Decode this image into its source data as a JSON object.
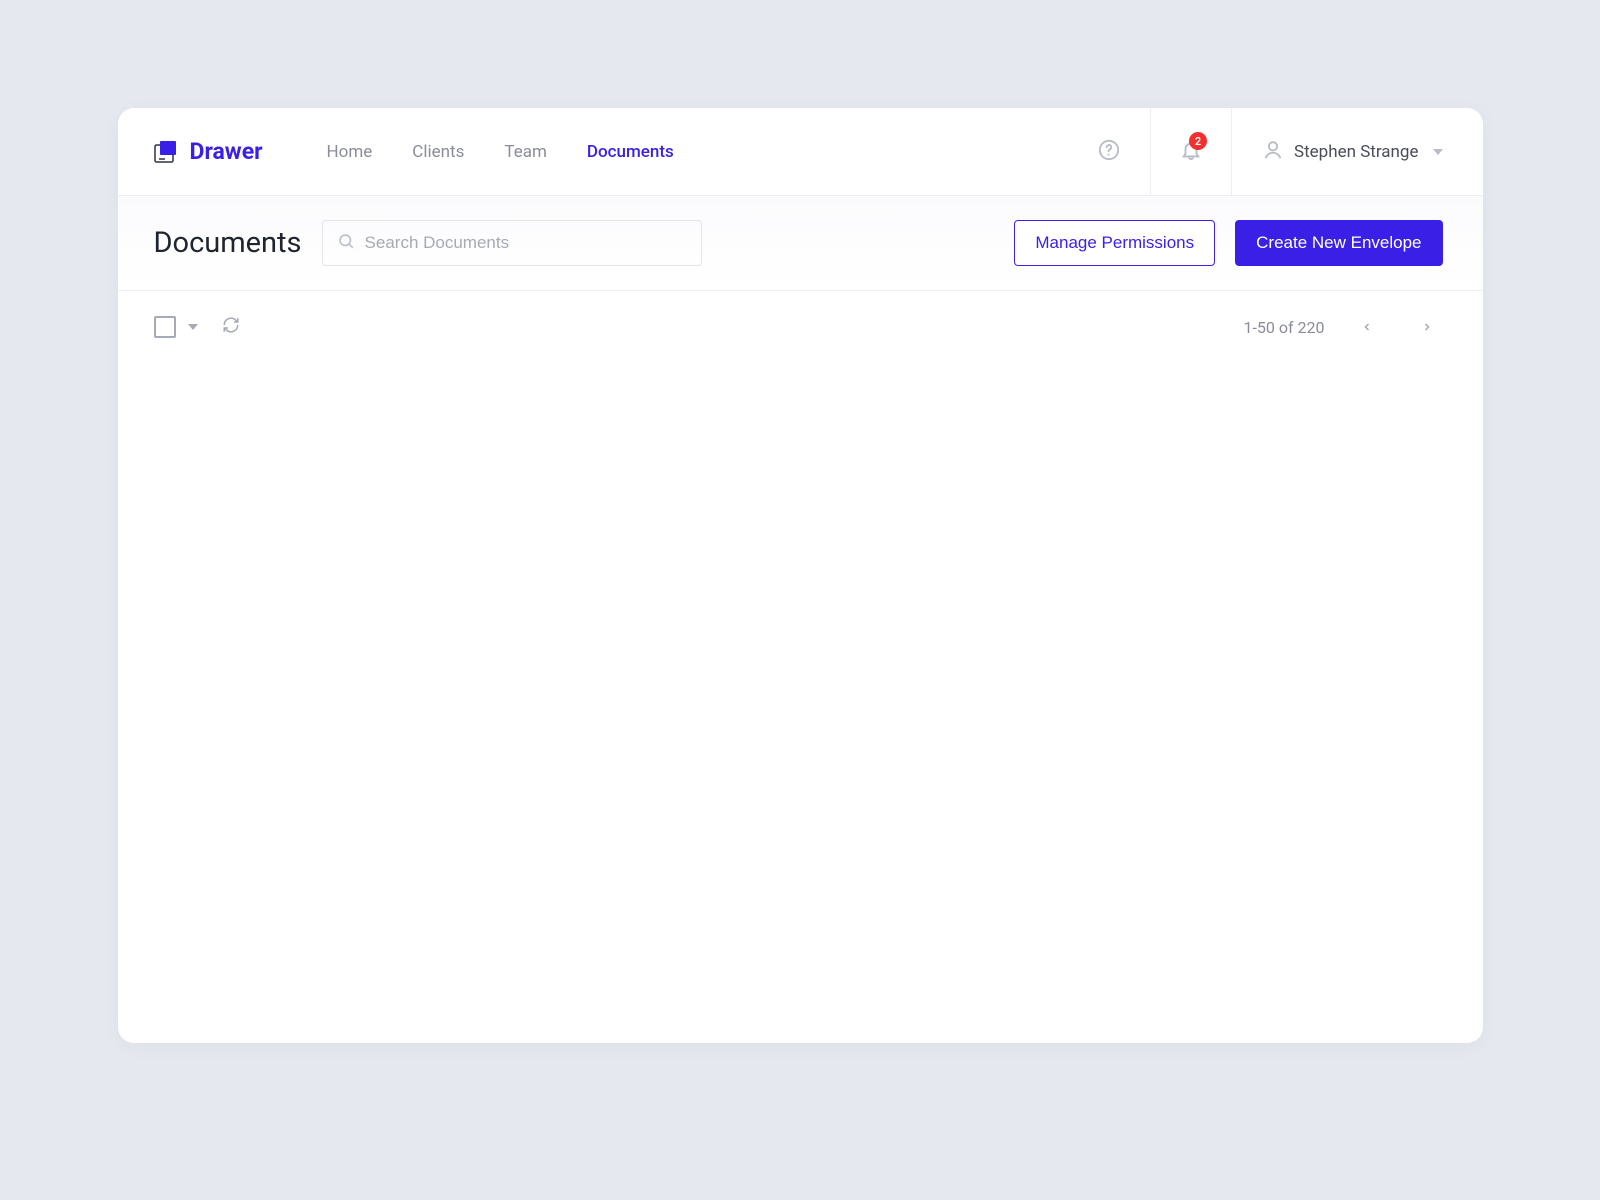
{
  "brand": {
    "name": "Drawer"
  },
  "nav": {
    "items": [
      "Home",
      "Clients",
      "Team",
      "Documents"
    ],
    "active": "Documents"
  },
  "notifications": {
    "count": "2"
  },
  "user": {
    "name": "Stephen Strange"
  },
  "page": {
    "title": "Documents",
    "search_placeholder": "Search Documents"
  },
  "actions": {
    "manage_permissions": "Manage Permissions",
    "create_envelope": "Create New Envelope"
  },
  "pagination": {
    "label": "1-50 of 220"
  },
  "colors": {
    "primary": "#3a1fe6",
    "badge": "#f23030"
  }
}
